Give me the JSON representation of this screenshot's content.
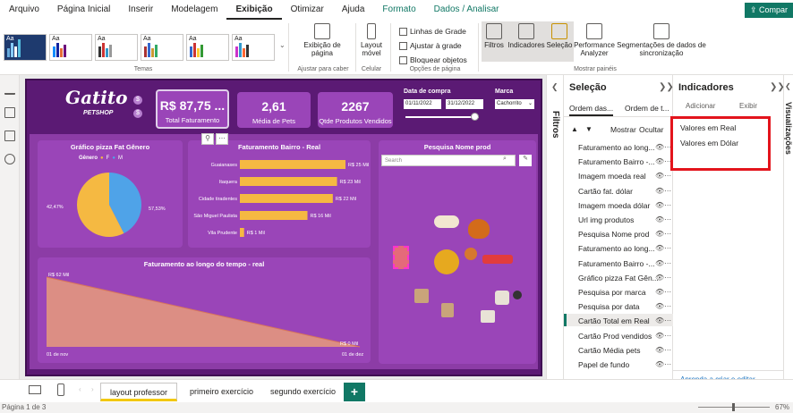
{
  "menu": [
    "Arquivo",
    "Página Inicial",
    "Inserir",
    "Modelagem",
    "Exibição",
    "Otimizar",
    "Ajuda",
    "Formato",
    "Dados / Analisar"
  ],
  "share_label": "Compar",
  "ribbon": {
    "themes_label": "Temas",
    "page_view": "Exibição de página",
    "adjust_label": "Ajustar para caber",
    "mobile_layout": "Layout móvel",
    "mobile_group": "Celular",
    "grid_lines": "Linhas de Grade",
    "snap_grid": "Ajustar à grade",
    "lock_objects": "Bloquear objetos",
    "page_options": "Opções de página",
    "filters": "Filtros",
    "bookmarks": "Indicadores",
    "selection": "Seleção",
    "perf_analyzer": "Performance Analyzer",
    "slicer_sync": "Segmentações de dados de sincronização",
    "show_panes": "Mostrar painéis"
  },
  "report": {
    "logo_name": "Gatito",
    "logo_sub": "PETSHOP",
    "card_total": {
      "value": "R$ 87,75 ...",
      "label": "Total Faturamento"
    },
    "card_avg": {
      "value": "2,61",
      "label": "Média de Pets"
    },
    "card_qty": {
      "value": "2267",
      "label": "Qtde Produtos Vendidos"
    },
    "date_label": "Data de compra",
    "date_from": "01/11/2022",
    "date_to": "31/12/2022",
    "brand_label": "Marca",
    "brand_value": "Cachorrito",
    "pie_title": "Gráfico pizza Fat Gênero",
    "pie_legend_title": "Gênero",
    "pie_legend": [
      "F",
      "M"
    ],
    "bar_title": "Faturamento Bairro - Real",
    "search_title": "Pesquisa Nome prod",
    "search_placeholder": "Search",
    "line_title": "Faturamento ao longo do tempo - real",
    "line_start_label": "R$ 62 Mil",
    "line_end_label": "R$ 0 Mil",
    "line_x_start": "01 de nov",
    "line_x_end": "01 de dez"
  },
  "chart_data": [
    {
      "type": "pie",
      "title": "Gráfico pizza Fat Gênero",
      "legend_title": "Gênero",
      "categories": [
        "F",
        "M"
      ],
      "values": [
        42.47,
        57.53
      ],
      "labels": [
        "42,47%",
        "57,53%"
      ],
      "colors": [
        "#4fa3e8",
        "#f5b942"
      ]
    },
    {
      "type": "bar",
      "title": "Faturamento Bairro - Real",
      "categories": [
        "Guaianases",
        "Itaquera",
        "Cidade tiradentes",
        "São Miguel Paulista",
        "Vila Prudente"
      ],
      "values": [
        25,
        23,
        22,
        16,
        1
      ],
      "labels": [
        "R$ 25 Mil",
        "R$ 23 Mil",
        "R$ 22 Mil",
        "R$ 16 Mil",
        "R$ 1 Mil"
      ],
      "color": "#f5b942"
    },
    {
      "type": "area",
      "title": "Faturamento ao longo do tempo - real",
      "x": [
        "01 de nov",
        "01 de dez"
      ],
      "values": [
        62,
        0
      ],
      "labels": [
        "R$ 62 Mil",
        "R$ 0 Mil"
      ],
      "color": "#e89b7a"
    }
  ],
  "pages": {
    "tabs": [
      "layout professor",
      "primeiro exercício",
      "segundo exercício"
    ],
    "active": 0,
    "add": "+"
  },
  "status": {
    "page": "Página 1 de 3",
    "zoom": "67%"
  },
  "filters_label": "Filtros",
  "selection": {
    "title": "Seleção",
    "tabs": [
      "Ordem das...",
      "Ordem de t..."
    ],
    "show": "Mostrar",
    "hide": "Ocultar",
    "items": [
      "Faturamento ao long...",
      "Faturamento Bairro -...",
      "Imagem moeda real",
      "Cartão fat. dólar",
      "Imagem moeda dólar",
      "Url img produtos",
      "Pesquisa Nome prod",
      "Faturamento ao long...",
      "Faturamento Bairro -...",
      "Gráfico pizza Fat Gên...",
      "Pesquisa por marca",
      "Pesquisa por data",
      "Cartão Total em Real",
      "Cartão Prod vendidos",
      "Cartão Média pets",
      "Papel de fundo"
    ],
    "selected": 12
  },
  "bookmarks": {
    "title": "Indicadores",
    "add": "Adicionar",
    "view": "Exibir",
    "items": [
      "Valores em Real",
      "Valores em Dólar"
    ],
    "help_link": "Aprenda a criar e editar indicadores"
  },
  "viz_label": "Visualizações"
}
